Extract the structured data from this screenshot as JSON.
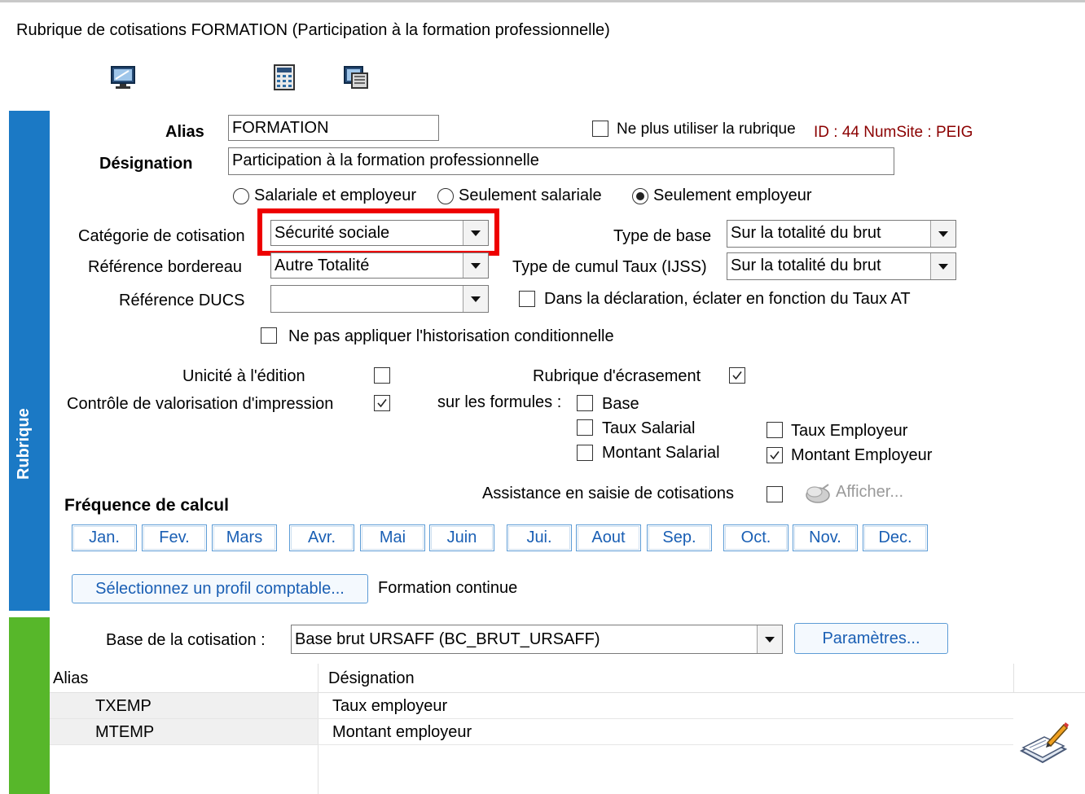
{
  "window": {
    "title": "Rubrique de cotisations FORMATION (Participation à la formation professionnelle)"
  },
  "toolbar": {
    "icons": [
      "monitor-icon",
      "calculator-icon",
      "windows-icon"
    ]
  },
  "sidebar": {
    "label": "Rubrique",
    "colors": {
      "blue": "#1b79c5",
      "green": "#57b72a"
    }
  },
  "form": {
    "alias_label": "Alias",
    "alias_value": "FORMATION",
    "designation_label": "Désignation",
    "designation_value": "Participation à la formation professionnelle",
    "no_longer_use_label": "Ne plus utiliser la rubrique",
    "no_longer_use_checked": false,
    "id_info": "ID : 44 NumSite : PEIG",
    "radios": [
      {
        "label": "Salariale et employeur",
        "selected": false
      },
      {
        "label": "Seulement salariale",
        "selected": false
      },
      {
        "label": "Seulement employeur",
        "selected": true
      }
    ],
    "categorie_label": "Catégorie de cotisation",
    "categorie_value": "Sécurité sociale",
    "ref_bordereau_label": "Référence bordereau",
    "ref_bordereau_value": "Autre Totalité",
    "ref_ducs_label": "Référence DUCS",
    "ref_ducs_value": "",
    "type_base_label": "Type de base",
    "type_base_value": "Sur la totalité du brut",
    "type_cumul_label": "Type de cumul Taux (IJSS)",
    "type_cumul_value": "Sur la totalité du brut",
    "eclater_label": "Dans la déclaration, éclater en fonction du Taux AT",
    "historisation_label": "Ne pas appliquer l'historisation conditionnelle",
    "unicite_label": "Unicité à l'édition",
    "unicite_checked": false,
    "controle_label": "Contrôle de valorisation d'impression",
    "controle_checked": true,
    "ecrasement_label": "Rubrique d'écrasement",
    "ecrasement_checked": true,
    "formules_label": "sur les formules :",
    "formules": {
      "base": "Base",
      "taux_salarial": "Taux Salarial",
      "montant_salarial": "Montant Salarial",
      "taux_employeur": "Taux Employeur",
      "montant_employeur": "Montant Employeur"
    },
    "assistance_label": "Assistance en saisie de cotisations",
    "afficher_label": "Afficher...",
    "frequence_label": "Fréquence de calcul",
    "months": [
      "Jan.",
      "Fev.",
      "Mars",
      "Avr.",
      "Mai",
      "Juin",
      "Jui.",
      "Aout",
      "Sep.",
      "Oct.",
      "Nov.",
      "Dec."
    ],
    "profil_button": "Sélectionnez un profil comptable...",
    "profil_value": "Formation continue",
    "base_cotisation_label": "Base de la cotisation :",
    "base_cotisation_value": "Base brut URSAFF (BC_BRUT_URSAFF)",
    "parametres_button": "Paramètres..."
  },
  "grid": {
    "headers": [
      "Alias",
      "Désignation"
    ],
    "rows": [
      {
        "alias": "TXEMP",
        "designation": "Taux employeur"
      },
      {
        "alias": "MTEMP",
        "designation": "Montant employeur"
      }
    ]
  },
  "colors": {
    "highlight": "#ee0000",
    "id_text": "#8b0000",
    "link": "#1a5fb4"
  }
}
